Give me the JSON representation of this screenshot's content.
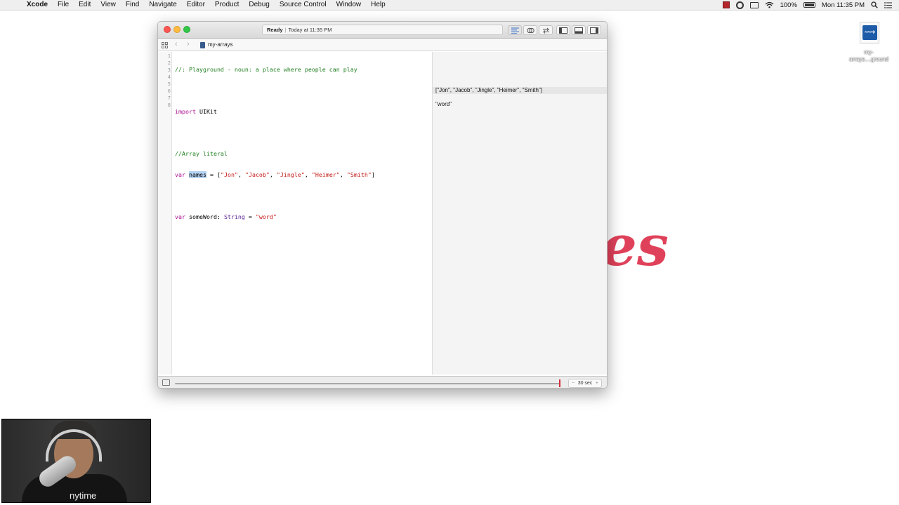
{
  "menubar": {
    "items": [
      "Xcode",
      "File",
      "Edit",
      "View",
      "Find",
      "Navigate",
      "Editor",
      "Product",
      "Debug",
      "Source Control",
      "Window",
      "Help"
    ],
    "battery": "100%",
    "clock": "Mon 11:35 PM"
  },
  "desktop": {
    "file_label": "my-arrays....ground",
    "background_logo_text": "es"
  },
  "window": {
    "activity_status": "Ready",
    "activity_time": "Today at 11:35 PM",
    "jump_bar_file": "my-arrays",
    "line_numbers": [
      "1",
      "2",
      "3",
      "4",
      "5",
      "6",
      "7",
      "8"
    ],
    "code": {
      "l1": "//: Playground - noun: a place where people can play",
      "l3_kw": "import",
      "l3_rest": " UIKit",
      "l5": "//Array literal",
      "l6_kw": "var",
      "l6_sel": "names",
      "l6_a": " = [",
      "l6_s1": "\"Jon\"",
      "l6_s2": "\"Jacob\"",
      "l6_s3": "\"Jingle\"",
      "l6_s4": "\"Heimer\"",
      "l6_s5": "\"Smith\"",
      "l6_end": "]",
      "comma": ", ",
      "l8_kw": "var",
      "l8_name": " someWord: ",
      "l8_type": "String",
      "l8_eq": " = ",
      "l8_str": "\"word\""
    },
    "results": [
      "[\"Jon\", \"Jacob\", \"Jingle\", \"Heimer\", \"Smith\"]",
      "\"word\""
    ],
    "run_duration": "30 sec",
    "stepper_minus": "−",
    "stepper_plus": "+"
  },
  "webcam": {
    "shirt_text": "nytime"
  },
  "colors": {
    "comment": "#1e7d1e",
    "keyword": "#aa0d91",
    "string": "#c41a16",
    "type": "#5c2699",
    "selection": "#b5d3f3",
    "close": "#fc5753",
    "minimize": "#fdbc40",
    "zoom": "#33c748",
    "timeline_thumb": "#d42b3a"
  },
  "icons": {
    "apple": "apple-icon",
    "wifi": "wifi-icon",
    "search": "search-icon",
    "notifications": "list-icon"
  }
}
